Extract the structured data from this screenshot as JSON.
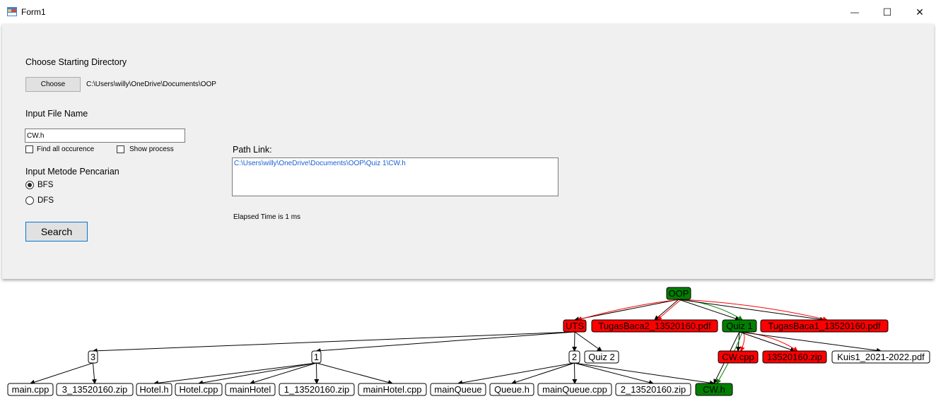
{
  "window": {
    "title": "Form1",
    "minimize_glyph": "—",
    "maximize_glyph": "☐",
    "close_glyph": "✕"
  },
  "form": {
    "choose_dir_label": "Choose Starting Directory",
    "choose_button": "Choose",
    "start_dir": "C:\\Users\\willy\\OneDrive\\Documents\\OOP",
    "input_file_label": "Input File Name",
    "file_name": "CW.h",
    "find_all_label": "Find all occurence",
    "find_all_checked": false,
    "show_process_label": "Show process",
    "show_process_checked": false,
    "method_label": "Input Metode Pencarian",
    "bfs_label": "BFS",
    "dfs_label": "DFS",
    "selected_method": "BFS",
    "search_button": "Search",
    "path_link_label": "Path Link:",
    "path_link": "C:\\Users\\willy\\OneDrive\\Documents\\OOP\\Quiz 1\\CW.h",
    "elapsed": "Elapsed Time is 1 ms"
  },
  "graph": {
    "colors": {
      "found": "#008000",
      "visited": "#ff0000",
      "unvisited": "#ffffff"
    },
    "nodes": [
      {
        "id": "oop",
        "label": "OOP",
        "status": "found"
      },
      {
        "id": "uts",
        "label": "UTS",
        "status": "visited"
      },
      {
        "id": "tb2",
        "label": "TugasBaca2_13520160.pdf",
        "status": "visited"
      },
      {
        "id": "quiz1",
        "label": "Quiz 1",
        "status": "found"
      },
      {
        "id": "tb1",
        "label": "TugasBaca1_13520160.pdf",
        "status": "visited"
      },
      {
        "id": "n3",
        "label": "3",
        "status": "unvisited"
      },
      {
        "id": "n1",
        "label": "1",
        "status": "unvisited"
      },
      {
        "id": "n2",
        "label": "2",
        "status": "unvisited"
      },
      {
        "id": "quiz2",
        "label": "Quiz 2",
        "status": "unvisited"
      },
      {
        "id": "cwcpp",
        "label": "CW.cpp",
        "status": "visited"
      },
      {
        "id": "zip160",
        "label": "13520160.zip",
        "status": "visited"
      },
      {
        "id": "kuis1",
        "label": "Kuis1_2021-2022.pdf",
        "status": "unvisited"
      },
      {
        "id": "maincpp",
        "label": "main.cpp",
        "status": "unvisited"
      },
      {
        "id": "zip3",
        "label": "3_13520160.zip",
        "status": "unvisited"
      },
      {
        "id": "hotelh",
        "label": "Hotel.h",
        "status": "unvisited"
      },
      {
        "id": "hotelcpp",
        "label": "Hotel.cpp",
        "status": "unvisited"
      },
      {
        "id": "mainhotel",
        "label": "mainHotel",
        "status": "unvisited"
      },
      {
        "id": "zip1",
        "label": "1_13520160.zip",
        "status": "unvisited"
      },
      {
        "id": "mainhotelcpp",
        "label": "mainHotel.cpp",
        "status": "unvisited"
      },
      {
        "id": "mainqueue",
        "label": "mainQueue",
        "status": "unvisited"
      },
      {
        "id": "queueh",
        "label": "Queue.h",
        "status": "unvisited"
      },
      {
        "id": "mainqueuecpp",
        "label": "mainQueue.cpp",
        "status": "unvisited"
      },
      {
        "id": "zip2",
        "label": "2_13520160.zip",
        "status": "unvisited"
      },
      {
        "id": "cwh",
        "label": "CW.h",
        "status": "found"
      }
    ],
    "edges": [
      {
        "from": "oop",
        "to": "uts",
        "color": "black"
      },
      {
        "from": "oop",
        "to": "uts",
        "color": "red"
      },
      {
        "from": "oop",
        "to": "tb2",
        "color": "black"
      },
      {
        "from": "oop",
        "to": "tb2",
        "color": "red"
      },
      {
        "from": "oop",
        "to": "quiz1",
        "color": "black"
      },
      {
        "from": "oop",
        "to": "quiz1",
        "color": "green"
      },
      {
        "from": "oop",
        "to": "tb1",
        "color": "black"
      },
      {
        "from": "oop",
        "to": "tb1",
        "color": "red"
      },
      {
        "from": "uts",
        "to": "n3",
        "color": "black"
      },
      {
        "from": "uts",
        "to": "n1",
        "color": "black"
      },
      {
        "from": "uts",
        "to": "n2",
        "color": "black"
      },
      {
        "from": "uts",
        "to": "quiz2",
        "color": "black"
      },
      {
        "from": "quiz1",
        "to": "cwcpp",
        "color": "black"
      },
      {
        "from": "quiz1",
        "to": "cwcpp",
        "color": "red"
      },
      {
        "from": "quiz1",
        "to": "zip160",
        "color": "black"
      },
      {
        "from": "quiz1",
        "to": "zip160",
        "color": "red"
      },
      {
        "from": "quiz1",
        "to": "kuis1",
        "color": "black"
      },
      {
        "from": "quiz1",
        "to": "cwh",
        "color": "black"
      },
      {
        "from": "quiz1",
        "to": "cwh",
        "color": "green"
      },
      {
        "from": "n3",
        "to": "maincpp",
        "color": "black"
      },
      {
        "from": "n3",
        "to": "zip3",
        "color": "black"
      },
      {
        "from": "n1",
        "to": "hotelh",
        "color": "black"
      },
      {
        "from": "n1",
        "to": "hotelcpp",
        "color": "black"
      },
      {
        "from": "n1",
        "to": "mainhotel",
        "color": "black"
      },
      {
        "from": "n1",
        "to": "zip1",
        "color": "black"
      },
      {
        "from": "n1",
        "to": "mainhotelcpp",
        "color": "black"
      },
      {
        "from": "n2",
        "to": "mainqueue",
        "color": "black"
      },
      {
        "from": "n2",
        "to": "queueh",
        "color": "black"
      },
      {
        "from": "n2",
        "to": "mainqueuecpp",
        "color": "black"
      },
      {
        "from": "n2",
        "to": "zip2",
        "color": "black"
      },
      {
        "from": "n2",
        "to": "cwh",
        "color": "black"
      }
    ]
  }
}
